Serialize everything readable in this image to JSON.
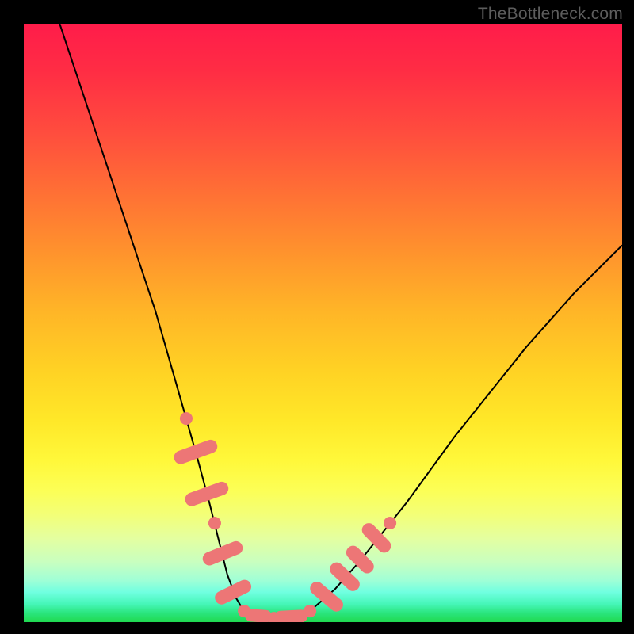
{
  "watermark": "TheBottleneck.com",
  "colors": {
    "frame": "#000000",
    "curve": "#000000",
    "marker": "#ed7676",
    "watermark_text": "#5d5d5d"
  },
  "chart_data": {
    "type": "line",
    "title": "",
    "xlabel": "",
    "ylabel": "",
    "xlim": [
      0,
      100
    ],
    "ylim": [
      0,
      100
    ],
    "grid": false,
    "legend": false,
    "series": [
      {
        "name": "bottleneck-curve",
        "x": [
          6,
          10,
          14,
          18,
          22,
          25,
          27,
          29,
          31,
          32.5,
          34,
          35.5,
          37,
          39,
          44,
          48,
          52,
          56,
          60,
          64,
          68,
          72,
          76,
          80,
          84,
          88,
          92,
          96,
          100
        ],
        "y": [
          100,
          88,
          76,
          64,
          52,
          41.5,
          34.5,
          27.5,
          20,
          14,
          8,
          4,
          1.5,
          0.5,
          0.5,
          2,
          5.5,
          10,
          15,
          20,
          25.5,
          31,
          36,
          41,
          46,
          50.5,
          55,
          59,
          63
        ]
      }
    ],
    "markers": {
      "shape": "rounded-bar",
      "fill": "#ed7676",
      "segments": [
        {
          "label": "left-dot-top",
          "cx": 27.2,
          "cy": 34.0,
          "w": 2.1,
          "h": 2.1,
          "angle": 70
        },
        {
          "label": "left-bar-1",
          "cx": 28.8,
          "cy": 28.5,
          "w": 2.2,
          "h": 7.5,
          "angle": 70
        },
        {
          "label": "left-bar-2",
          "cx": 30.6,
          "cy": 21.5,
          "w": 2.2,
          "h": 7.5,
          "angle": 70
        },
        {
          "label": "left-dot-mid",
          "cx": 31.9,
          "cy": 16.5,
          "w": 2.1,
          "h": 2.1,
          "angle": 70
        },
        {
          "label": "left-bar-3",
          "cx": 33.2,
          "cy": 11.5,
          "w": 2.2,
          "h": 7.0,
          "angle": 68
        },
        {
          "label": "left-bar-4",
          "cx": 35.0,
          "cy": 5.0,
          "w": 2.2,
          "h": 6.5,
          "angle": 64
        },
        {
          "label": "bottom-dot-1",
          "cx": 36.8,
          "cy": 1.8,
          "w": 2.1,
          "h": 2.1,
          "angle": 0
        },
        {
          "label": "bottom-bar-1",
          "cx": 39.2,
          "cy": 1.0,
          "w": 4.5,
          "h": 2.1,
          "angle": 4
        },
        {
          "label": "bottom-dot-2",
          "cx": 41.8,
          "cy": 0.7,
          "w": 2.1,
          "h": 2.1,
          "angle": 0
        },
        {
          "label": "bottom-bar-2",
          "cx": 44.6,
          "cy": 0.9,
          "w": 5.5,
          "h": 2.1,
          "angle": -3
        },
        {
          "label": "right-dot-low",
          "cx": 47.8,
          "cy": 1.9,
          "w": 2.1,
          "h": 2.1,
          "angle": -20
        },
        {
          "label": "right-bar-1",
          "cx": 50.6,
          "cy": 4.2,
          "w": 2.2,
          "h": 6.5,
          "angle": -50
        },
        {
          "label": "right-bar-2",
          "cx": 53.6,
          "cy": 7.5,
          "w": 2.2,
          "h": 6.0,
          "angle": -47
        },
        {
          "label": "right-bar-3",
          "cx": 56.2,
          "cy": 10.5,
          "w": 2.2,
          "h": 5.5,
          "angle": -45
        },
        {
          "label": "right-bar-4",
          "cx": 59.0,
          "cy": 14.0,
          "w": 2.2,
          "h": 6.0,
          "angle": -44
        },
        {
          "label": "right-dot-top",
          "cx": 61.2,
          "cy": 16.6,
          "w": 2.1,
          "h": 2.1,
          "angle": -44
        }
      ]
    }
  }
}
